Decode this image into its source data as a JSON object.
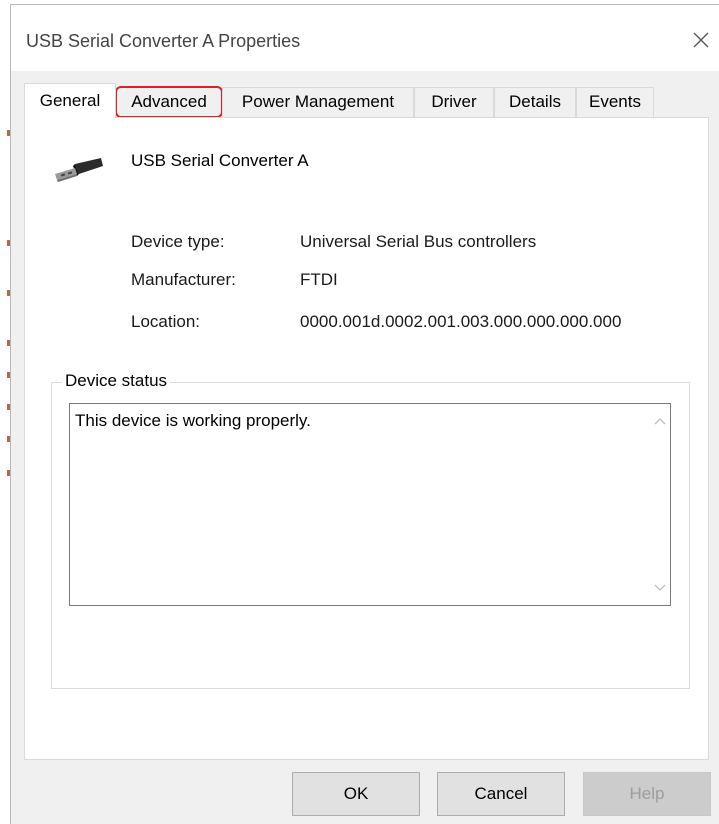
{
  "window": {
    "title": "USB Serial Converter A Properties"
  },
  "tabs": [
    {
      "label": "General"
    },
    {
      "label": "Advanced"
    },
    {
      "label": "Power Management"
    },
    {
      "label": "Driver"
    },
    {
      "label": "Details"
    },
    {
      "label": "Events"
    }
  ],
  "active_tab": "General",
  "highlight_color": "#e02020",
  "device": {
    "name": "USB Serial Converter A",
    "icon": "usb-plug-icon",
    "properties": [
      {
        "label": "Device type:",
        "value": "Universal Serial Bus controllers"
      },
      {
        "label": "Manufacturer:",
        "value": "FTDI"
      },
      {
        "label": "Location:",
        "value": "0000.001d.0002.001.003.000.000.000.000"
      }
    ]
  },
  "status": {
    "group_label": "Device status",
    "text": "This device is working properly."
  },
  "buttons": {
    "ok": "OK",
    "cancel": "Cancel",
    "help": "Help"
  }
}
